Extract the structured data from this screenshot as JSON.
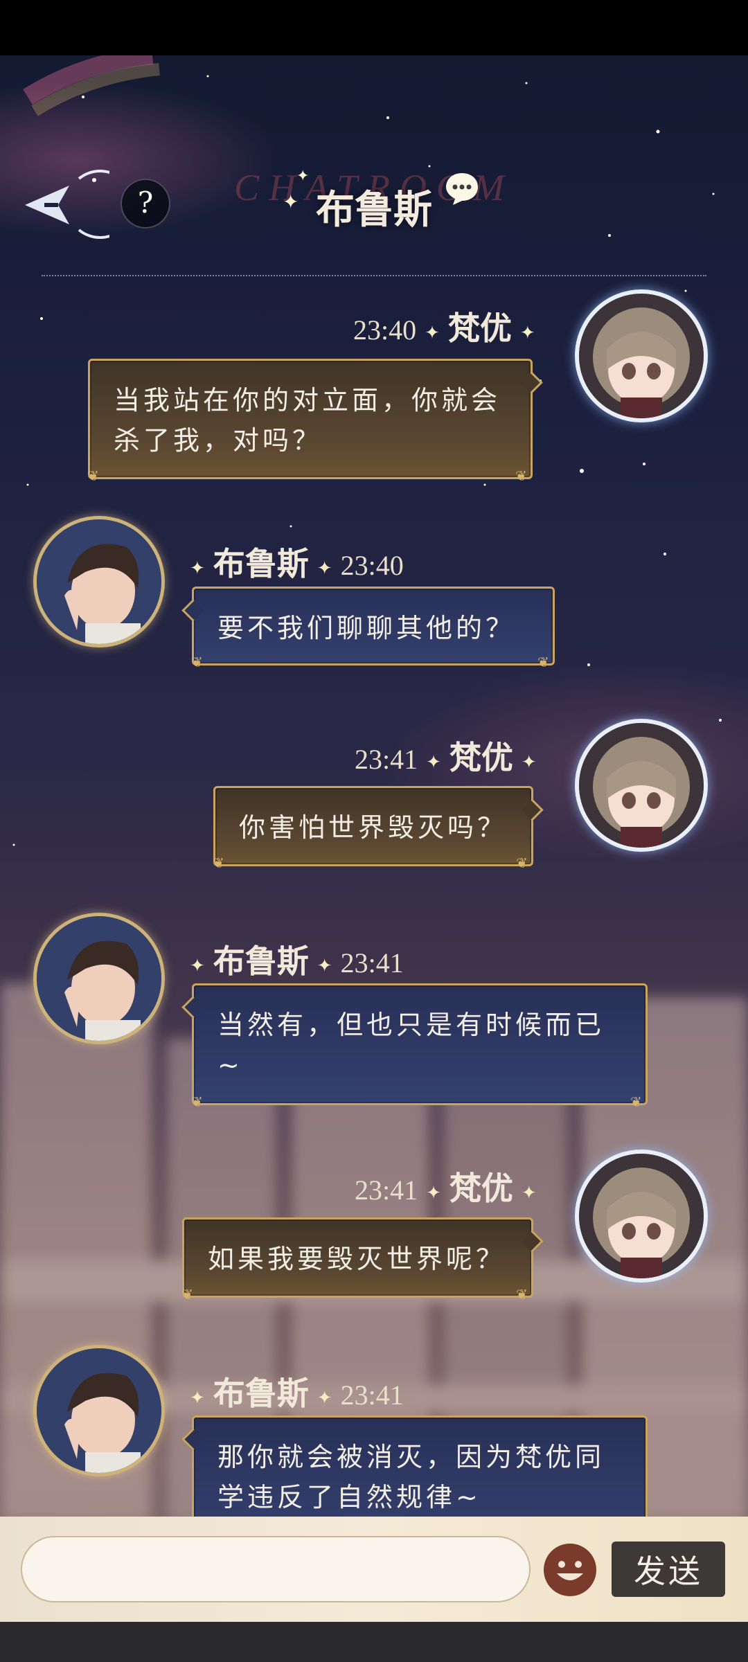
{
  "header": {
    "title": "布鲁斯",
    "watermark": "CHATROOM",
    "help_label": "?"
  },
  "messages": [
    {
      "sender": "梵优",
      "time": "23:40",
      "text": "当我站在你的对立面，你就会杀了我，对吗？",
      "side": "right"
    },
    {
      "sender": "布鲁斯",
      "time": "23:40",
      "text": "要不我们聊聊其他的？",
      "side": "left"
    },
    {
      "sender": "梵优",
      "time": "23:41",
      "text": "你害怕世界毁灭吗？",
      "side": "right"
    },
    {
      "sender": "布鲁斯",
      "time": "23:41",
      "text": "当然有，但也只是有时候而已~",
      "side": "left"
    },
    {
      "sender": "梵优",
      "time": "23:41",
      "text": "如果我要毁灭世界呢？",
      "side": "right"
    },
    {
      "sender": "布鲁斯",
      "time": "23:41",
      "text": "那你就会被消灭，因为梵优同学违反了自然规律~",
      "side": "left"
    }
  ],
  "input": {
    "value": "",
    "placeholder": "",
    "emoji_icon": "smiley-icon",
    "send_label": "发送"
  },
  "colors": {
    "bubble_border": "#c9a45e",
    "outgoing_bubble": "#5a4731",
    "incoming_bubble": "#34406f",
    "send_button": "#3d3936"
  }
}
